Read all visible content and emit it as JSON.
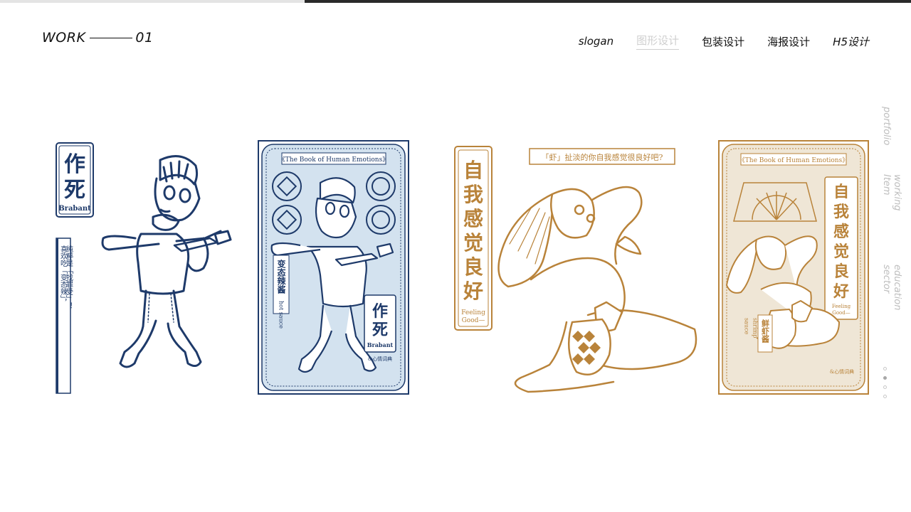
{
  "header": {
    "work_label": "WORK",
    "work_number": "01"
  },
  "nav": [
    {
      "label": "slogan",
      "active": false,
      "italic": true
    },
    {
      "label": "图形设计",
      "active": true,
      "italic": false
    },
    {
      "label": "包装设计",
      "active": false,
      "italic": false
    },
    {
      "label": "海报设计",
      "active": false,
      "italic": false
    },
    {
      "label": "H5设计",
      "active": false,
      "italic": true
    }
  ],
  "side_nav": [
    "portfolio",
    "working Item",
    "education sector"
  ],
  "pager": {
    "count": 4,
    "current": 2
  },
  "art1": {
    "badge_big": [
      "作",
      "死"
    ],
    "badge_sub": "Brabant",
    "tagline_col1": "喜欢吃「变态辣」，",
    "tagline_col2": "纯粹是「找罪受」！"
  },
  "art2": {
    "top": "《The Book of Human Emotions》",
    "vertical_cn": "变态辣酱",
    "vertical_en": "hot sauce",
    "badge_big": [
      "作",
      "死"
    ],
    "badge_sub": "Brabant",
    "footer": "&心情词典"
  },
  "art3": {
    "title_chars": [
      "自",
      "我",
      "感",
      "觉",
      "良",
      "好"
    ],
    "title_en_1": "Feeling",
    "title_en_2": "Good—",
    "caption": "「虾」扯淡的你自我感觉很良好吧?"
  },
  "art4": {
    "top": "《The Book of Human Emotions》",
    "title_chars": [
      "自",
      "我",
      "感",
      "觉",
      "良",
      "好"
    ],
    "title_en_1": "Feeling",
    "title_en_2": "Good—",
    "vertical_cn": "鲜虾酱",
    "vertical_en_1": "shrimp",
    "vertical_en_2": "sauce",
    "footer": "&心情词典"
  },
  "colors": {
    "navy": "#1e3a6a",
    "gold": "#b9833a",
    "light_blue": "#d3e2ef",
    "cream": "#efe6d6"
  }
}
